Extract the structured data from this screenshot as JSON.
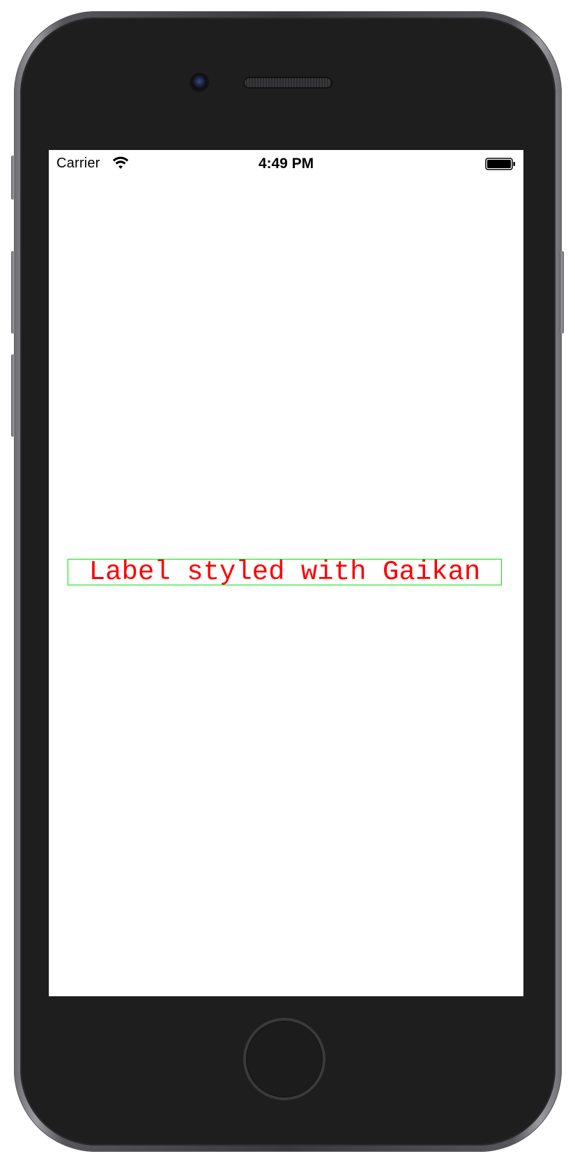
{
  "status_bar": {
    "carrier": "Carrier",
    "time": "4:49 PM",
    "wifi_icon": "wifi-icon",
    "battery_icon": "battery-full-icon"
  },
  "main": {
    "label_text": "Label styled with Gaikan",
    "label_text_color": "#ff0000",
    "label_border_color": "#00e600"
  }
}
